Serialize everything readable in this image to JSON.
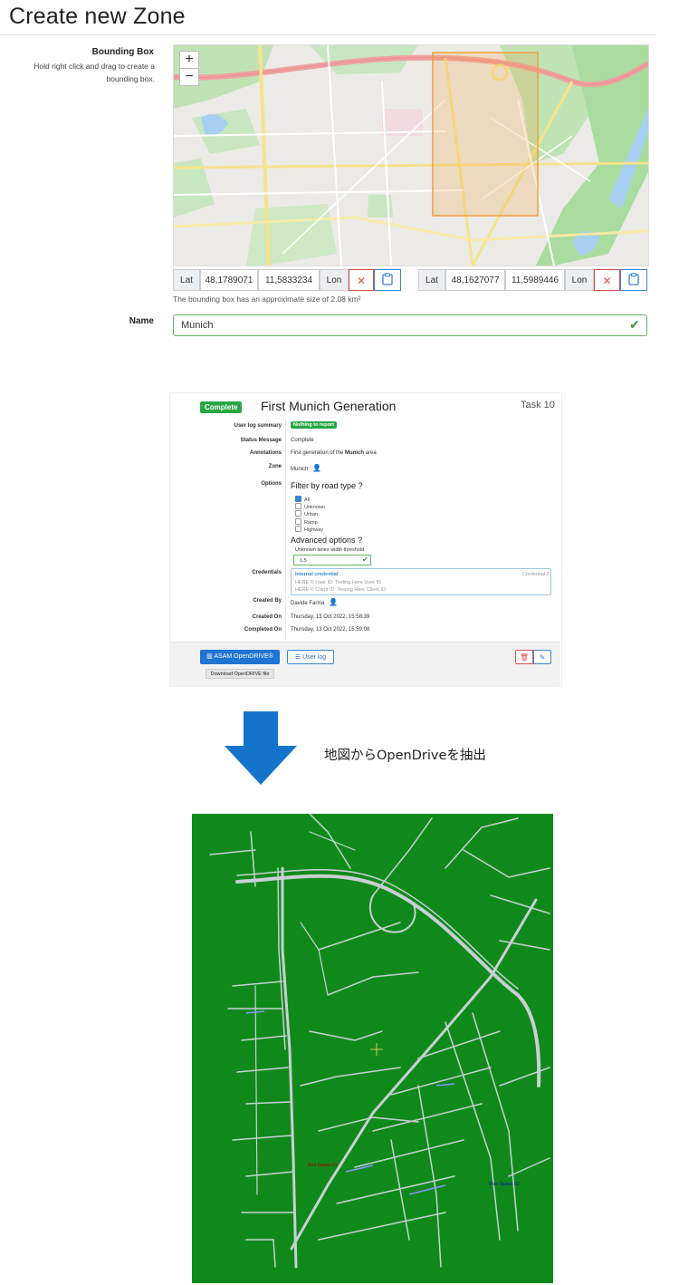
{
  "zone_form": {
    "title": "Create new Zone",
    "bounding_box_label": "Bounding Box",
    "bounding_box_help": "Hold right click and drag to create a bounding box.",
    "zoom_in": "+",
    "zoom_out": "−",
    "corner1": {
      "lat_label": "Lat",
      "lat": "48,1789071",
      "lon": "11,5833234",
      "lon_label": "Lon"
    },
    "corner2": {
      "lat_label": "Lat",
      "lat": "48,1627077",
      "lon": "11,5989446",
      "lon_label": "Lon"
    },
    "size_note": "The bounding box has an approximate size of 2.08 km²",
    "name_label": "Name",
    "name_value": "Munich"
  },
  "task": {
    "status_badge": "Complete",
    "title": "First Munich Generation",
    "number": "Task 10",
    "user_log_summary_label": "User log summary",
    "user_log_summary_badge": "Nothing to report",
    "status_message_label": "Status Message",
    "status_message": "Complete",
    "annotations_label": "Annotations",
    "annotations_prefix": "First generation of the",
    "annotations_bold": "Munich",
    "annotations_suffix": "area",
    "zone_label": "Zone",
    "zone_value": "Munich",
    "options_label": "Options",
    "filter_title": "Filter by road type",
    "filter_help": "?",
    "road_types": [
      {
        "label": "All",
        "checked": true
      },
      {
        "label": "Unknown",
        "checked": false
      },
      {
        "label": "Urban",
        "checked": false
      },
      {
        "label": "Ramp",
        "checked": false
      },
      {
        "label": "Highway",
        "checked": false
      }
    ],
    "advanced_title": "Advanced options",
    "advanced_help": "?",
    "threshold_label": "Unknown lanes width threshold",
    "threshold_value": "1.5",
    "credentials_label": "Credentials",
    "credential_name": "Internal credential",
    "credential_user": "HERE © User ID: Testing Here User ID",
    "credential_client": "HERE © Client ID: Testing Here Client ID",
    "credential_tag": "Credential 2",
    "created_by_label": "Created By",
    "created_by": "Davide Farina",
    "created_on_label": "Created On",
    "created_on": "Thursday, 13 Oct 2022, 15:58:39",
    "completed_on_label": "Completed On",
    "completed_on": "Thursday, 13 Oct 2022, 15:59:08",
    "asam_button": "ASAM OpenDRIVE®",
    "user_log_button": "User log",
    "download_button": "Download OpenDRIVE file"
  },
  "caption": "地図からOpenDriveを抽出",
  "opendrive_view": {
    "background": "#0f8a1a",
    "labels": [
      {
        "text": "Red Spawn 01",
        "color": "#b00000"
      },
      {
        "text": "Blue Spawn 02",
        "color": "#0a1aa8"
      }
    ]
  },
  "colors": {
    "accent": "#1f74d4",
    "success": "#28a745",
    "danger": "#d9534f",
    "bbox": "#f0a03c"
  }
}
